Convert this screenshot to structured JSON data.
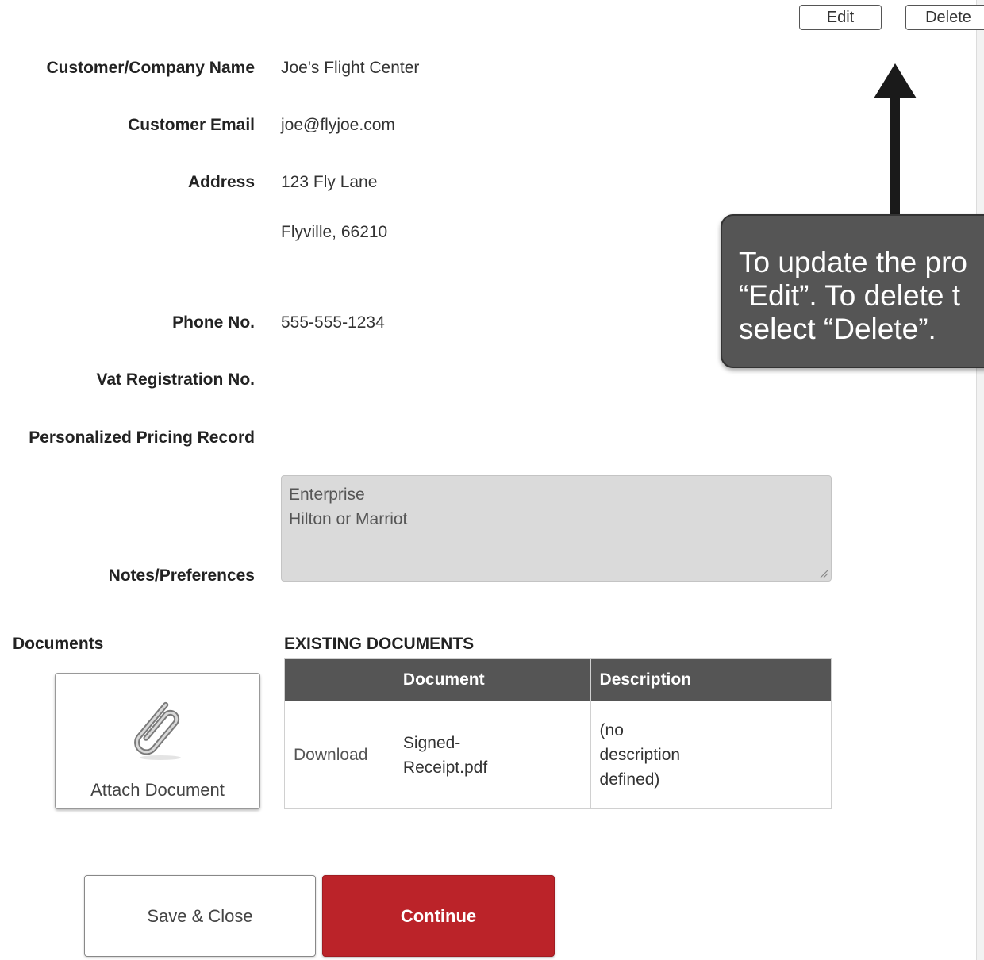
{
  "toolbar": {
    "edit_label": "Edit",
    "delete_label": "Delete"
  },
  "fields": {
    "company_label": "Customer/Company Name",
    "company_value": "Joe's Flight Center",
    "email_label": "Customer Email",
    "email_value": "joe@flyjoe.com",
    "address_label": "Address",
    "address_line1": "123 Fly Lane",
    "address_line2": "Flyville, 66210",
    "phone_label": "Phone No.",
    "phone_value": "555-555-1234",
    "vat_label": "Vat Registration No.",
    "pricing_label": "Personalized Pricing Record",
    "notes_label": "Notes/Preferences",
    "notes_line1": "Enterprise",
    "notes_line2": "Hilton or Marriot"
  },
  "documents": {
    "label": "Documents",
    "attach_label": "Attach Document",
    "existing_title": "EXISTING DOCUMENTS",
    "columns": [
      "",
      "Document",
      "Description"
    ],
    "rows": [
      {
        "action": "Download",
        "document_line1": "Signed-",
        "document_line2": "Receipt.pdf",
        "description_line1": "(no",
        "description_line2": "description",
        "description_line3": "defined)"
      }
    ]
  },
  "actions": {
    "save_close_label": "Save & Close",
    "continue_label": "Continue"
  },
  "callout": {
    "text_line1": "To update the pro",
    "text_line2": "“Edit”. To delete t",
    "text_line3": "select “Delete”."
  },
  "colors": {
    "continue_bg": "#bb2329",
    "table_header_bg": "#555555",
    "callout_bg": "#555555",
    "notes_bg": "#dadada"
  },
  "icons": {
    "attach": "paperclip-icon",
    "callout_arrow": "arrow-up-icon",
    "notes_grip": "resize-grip-icon"
  }
}
